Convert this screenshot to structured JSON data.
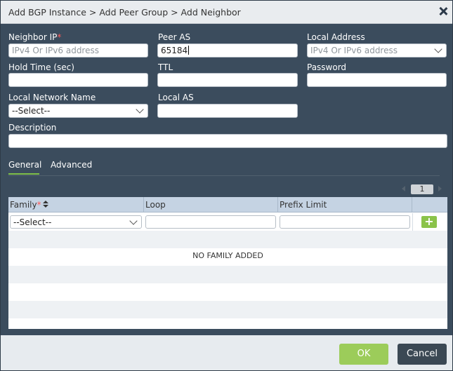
{
  "dialog": {
    "title": "Add BGP Instance > Add Peer Group > Add Neighbor"
  },
  "form": {
    "neighbor_ip": {
      "label": "Neighbor IP",
      "required_mark": "*",
      "value": "",
      "placeholder": "IPv4 Or IPv6 address"
    },
    "peer_as": {
      "label": "Peer AS",
      "value": "65184"
    },
    "local_address": {
      "label": "Local Address",
      "selected": "IPv4 Or IPv6 address"
    },
    "hold_time": {
      "label": "Hold Time (sec)",
      "value": ""
    },
    "ttl": {
      "label": "TTL",
      "value": ""
    },
    "password": {
      "label": "Password",
      "value": ""
    },
    "local_network_name": {
      "label": "Local Network Name",
      "selected": "--Select--"
    },
    "local_as": {
      "label": "Local AS",
      "value": ""
    },
    "description": {
      "label": "Description",
      "value": ""
    }
  },
  "tabs": [
    {
      "label": "General",
      "active": true
    },
    {
      "label": "Advanced",
      "active": false
    }
  ],
  "pager": {
    "current_page": "1"
  },
  "table": {
    "columns": [
      {
        "label": "Family",
        "required_mark": "*",
        "sortable": true
      },
      {
        "label": "Loop"
      },
      {
        "label": "Prefix Limit"
      },
      {
        "label": ""
      }
    ],
    "edit_row": {
      "family_selected": "--Select--",
      "loop": "",
      "prefix_limit": ""
    },
    "add_label": "+",
    "empty_message": "NO FAMILY ADDED"
  },
  "footer": {
    "ok_label": "OK",
    "cancel_label": "Cancel"
  },
  "colors": {
    "dialog_bg": "#3b4c5d",
    "accent_green": "#9ccc5a",
    "required_red": "#ff5a5a",
    "grid_header": "#c5d3e3"
  }
}
